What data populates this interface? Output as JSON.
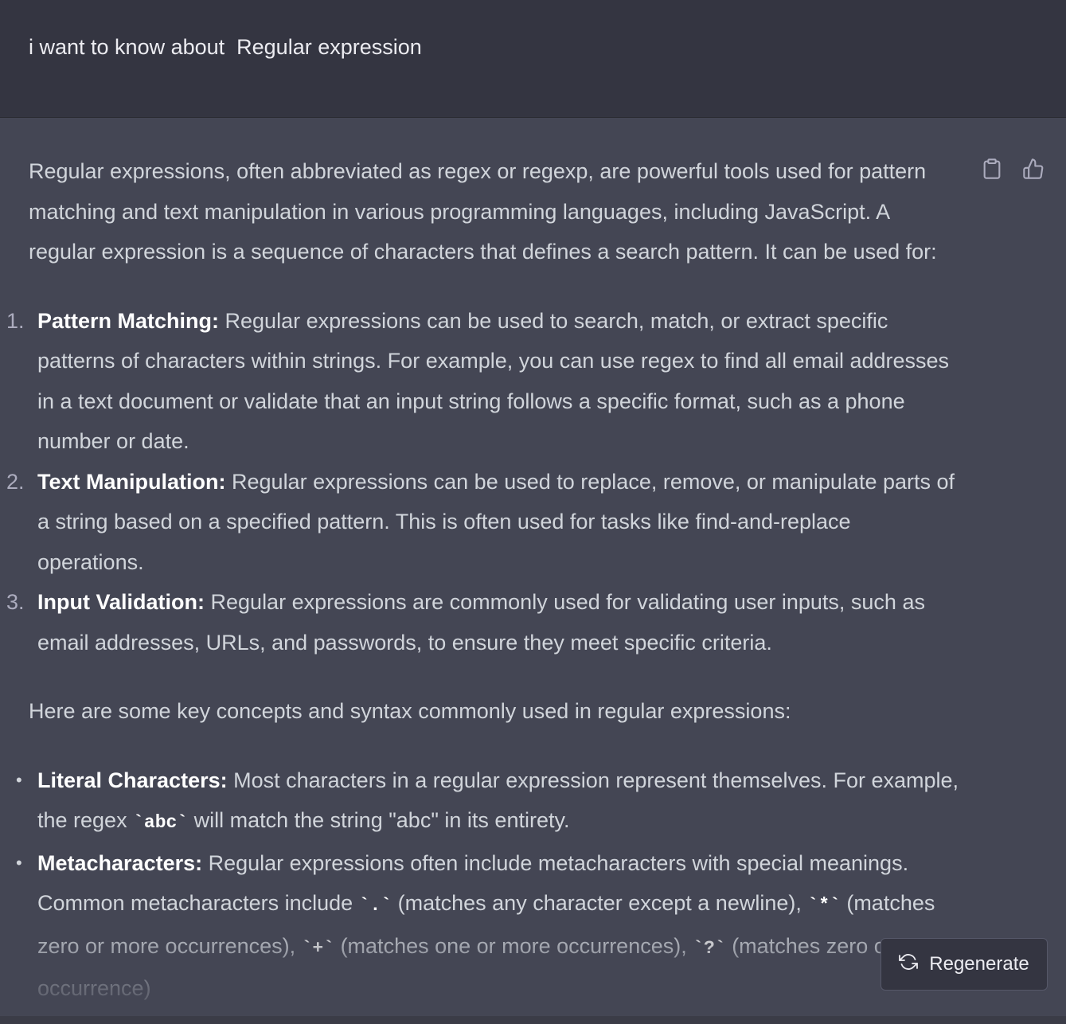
{
  "user_message": "i want to know about  Regular expression",
  "assistant": {
    "intro": "Regular expressions, often abbreviated as regex or regexp, are powerful tools used for pattern matching and text manipulation in various programming languages, including JavaScript. A regular expression is a sequence of characters that defines a search pattern. It can be used for:",
    "uses": [
      {
        "number": "1.",
        "title": "Pattern Matching:",
        "text": "Regular expressions can be used to search, match, or extract specific patterns of characters within strings. For example, you can use regex to find all email addresses in a text document or validate that an input string follows a specific format, such as a phone number or date."
      },
      {
        "number": "2.",
        "title": "Text Manipulation:",
        "text": "Regular expressions can be used to replace, remove, or manipulate parts of a string based on a specified pattern. This is often used for tasks like find-and-replace operations."
      },
      {
        "number": "3.",
        "title": "Input Validation:",
        "text": "Regular expressions are commonly used for validating user inputs, such as email addresses, URLs, and passwords, to ensure they meet specific criteria."
      }
    ],
    "concepts_intro": "Here are some key concepts and syntax commonly used in regular expressions:",
    "concepts": {
      "literal": {
        "title": "Literal Characters:",
        "text_before": "Most characters in a regular expression represent themselves. For example, the regex",
        "code": "`abc`",
        "text_after": "will match the string \"abc\" in its entirety."
      },
      "meta": {
        "title": "Metacharacters:",
        "text_1": "Regular expressions often include metacharacters with special meanings. Common metacharacters include",
        "code_1": "`.`",
        "text_2": "(matches any character except a newline),",
        "code_2": "`*`",
        "text_3": "(matches zero or more occurrences),",
        "code_3": "`+`",
        "text_4": "(matches one or more occurrences),",
        "code_4": "`?`",
        "text_5": "(matches zero or one occurrence)"
      }
    }
  },
  "actions": {
    "copy_icon": "clipboard-icon",
    "like_icon": "thumbs-up-icon"
  },
  "regenerate_label": "Regenerate"
}
